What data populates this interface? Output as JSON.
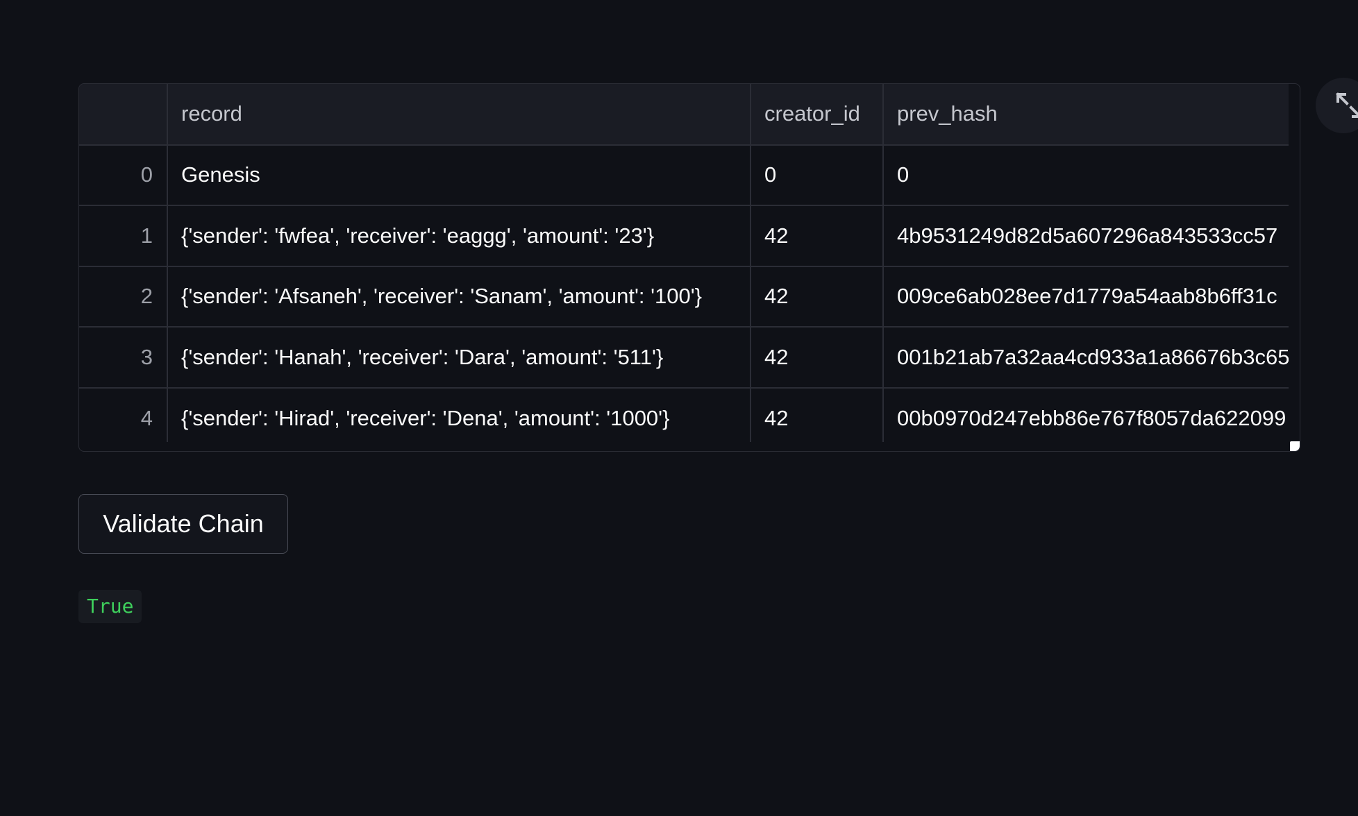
{
  "dataframe": {
    "columns": [
      "",
      "record",
      "creator_id",
      "prev_hash"
    ],
    "rows": [
      [
        "0",
        "Genesis",
        "0",
        "0"
      ],
      [
        "1",
        "{'sender': 'fwfea', 'receiver': 'eaggg', 'amount': '23'}",
        "42",
        "4b9531249d82d5a607296a843533cc57"
      ],
      [
        "2",
        "{'sender': 'Afsaneh', 'receiver': 'Sanam', 'amount': '100'}",
        "42",
        "009ce6ab028ee7d1779a54aab8b6ff31c"
      ],
      [
        "3",
        "{'sender': 'Hanah', 'receiver': 'Dara', 'amount': '511'}",
        "42",
        "001b21ab7a32aa4cd933a1a86676b3c65"
      ],
      [
        "4",
        "{'sender': 'Hirad', 'receiver': 'Dena', 'amount': '1000'}",
        "42",
        "00b0970d247ebb86e767f8057da622099"
      ]
    ]
  },
  "toolbar": {
    "expand_icon": "expand-arrows-icon"
  },
  "validate_button": {
    "label": "Validate Chain"
  },
  "result": {
    "value": "True",
    "color": "#3ecf5c"
  },
  "colors": {
    "background": "#0f1117",
    "header_background": "#1a1c24",
    "border": "#2b2d36",
    "text": "#fafafa",
    "success": "#3ecf5c"
  }
}
